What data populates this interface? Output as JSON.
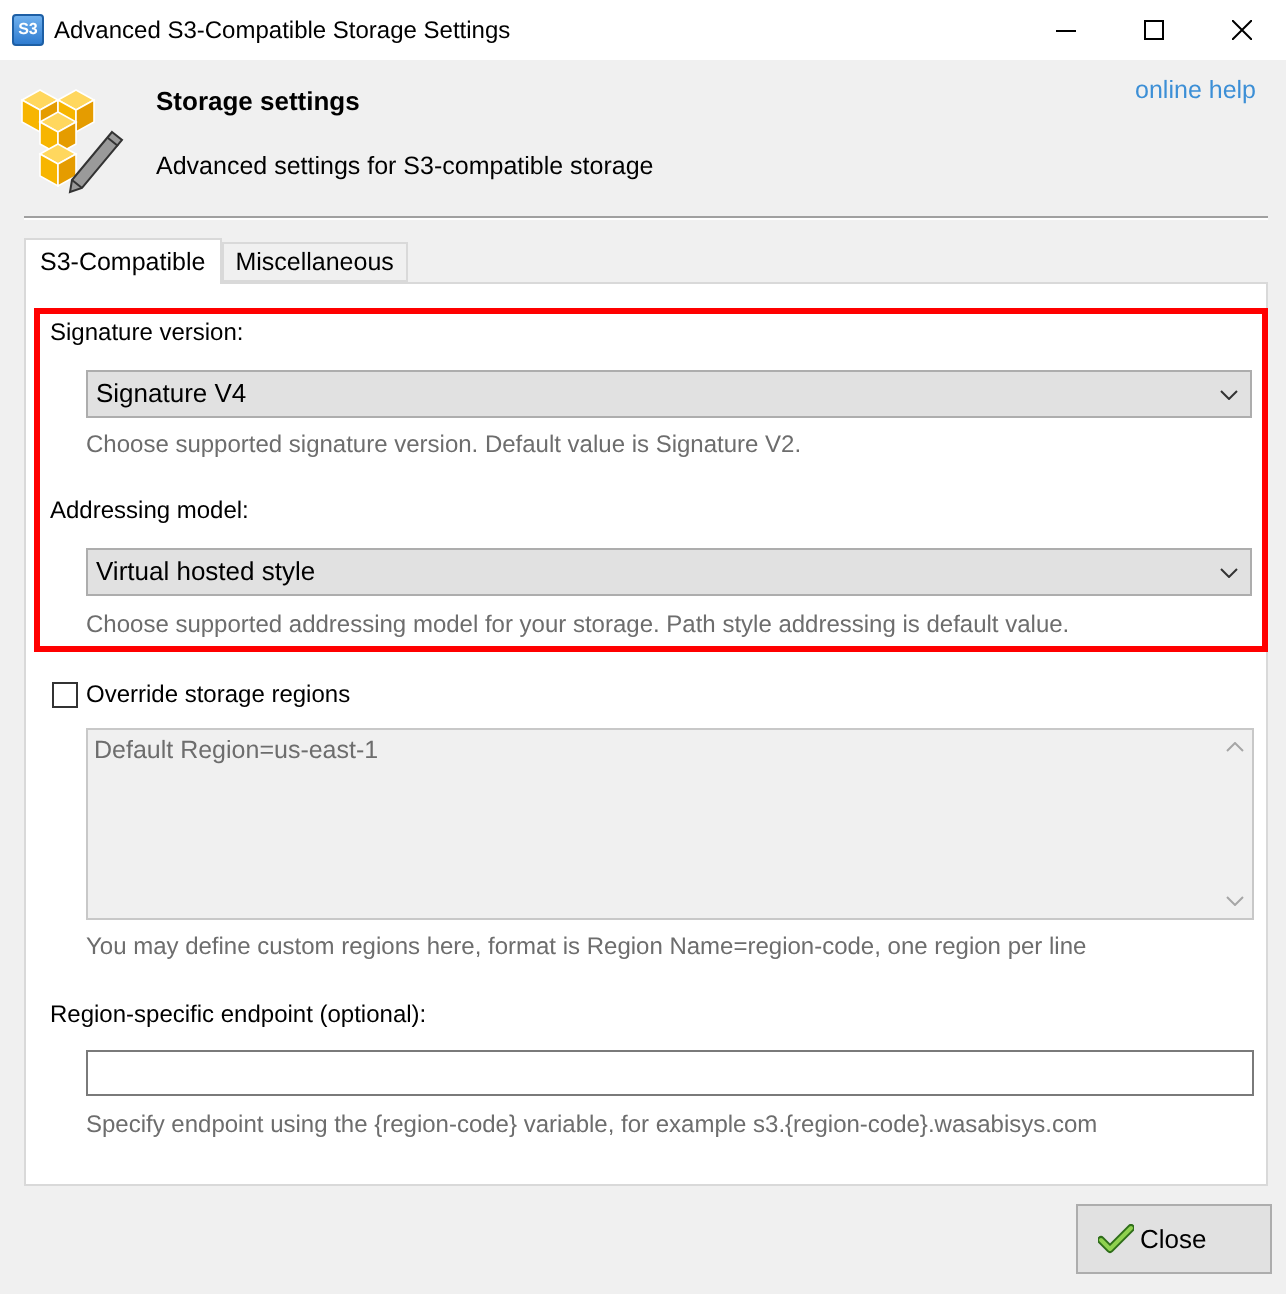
{
  "window": {
    "icon_label": "S3",
    "title": "Advanced S3-Compatible Storage Settings"
  },
  "header": {
    "title": "Storage settings",
    "subtitle": "Advanced settings for S3-compatible storage",
    "help_link": "online help"
  },
  "tabs": [
    {
      "label": "S3-Compatible",
      "selected": true
    },
    {
      "label": "Miscellaneous",
      "selected": false
    }
  ],
  "settings_group": {
    "highlighted": true,
    "fields": [
      {
        "label": "Signature version:",
        "value": "Signature V4",
        "hint": "Choose supported signature version. Default value is Signature V2."
      },
      {
        "label": "Addressing model:",
        "value": "Virtual hosted style",
        "hint": "Choose supported addressing model for your storage. Path style addressing is default value."
      }
    ]
  },
  "override_regions": {
    "label": "Override storage regions",
    "checked": false,
    "regions_field": {
      "value": "Default Region=us-east-1",
      "disabled": true
    },
    "hint": "You may define custom regions here, format is Region Name=region-code, one region per line"
  },
  "endpoint": {
    "label": "Region-specific endpoint (optional):",
    "hint": "Specify endpoint using the {region-code} variable, for example s3.{region-code}.wasabisys.com"
  },
  "buttons": [
    {
      "label": "Close"
    }
  ]
}
